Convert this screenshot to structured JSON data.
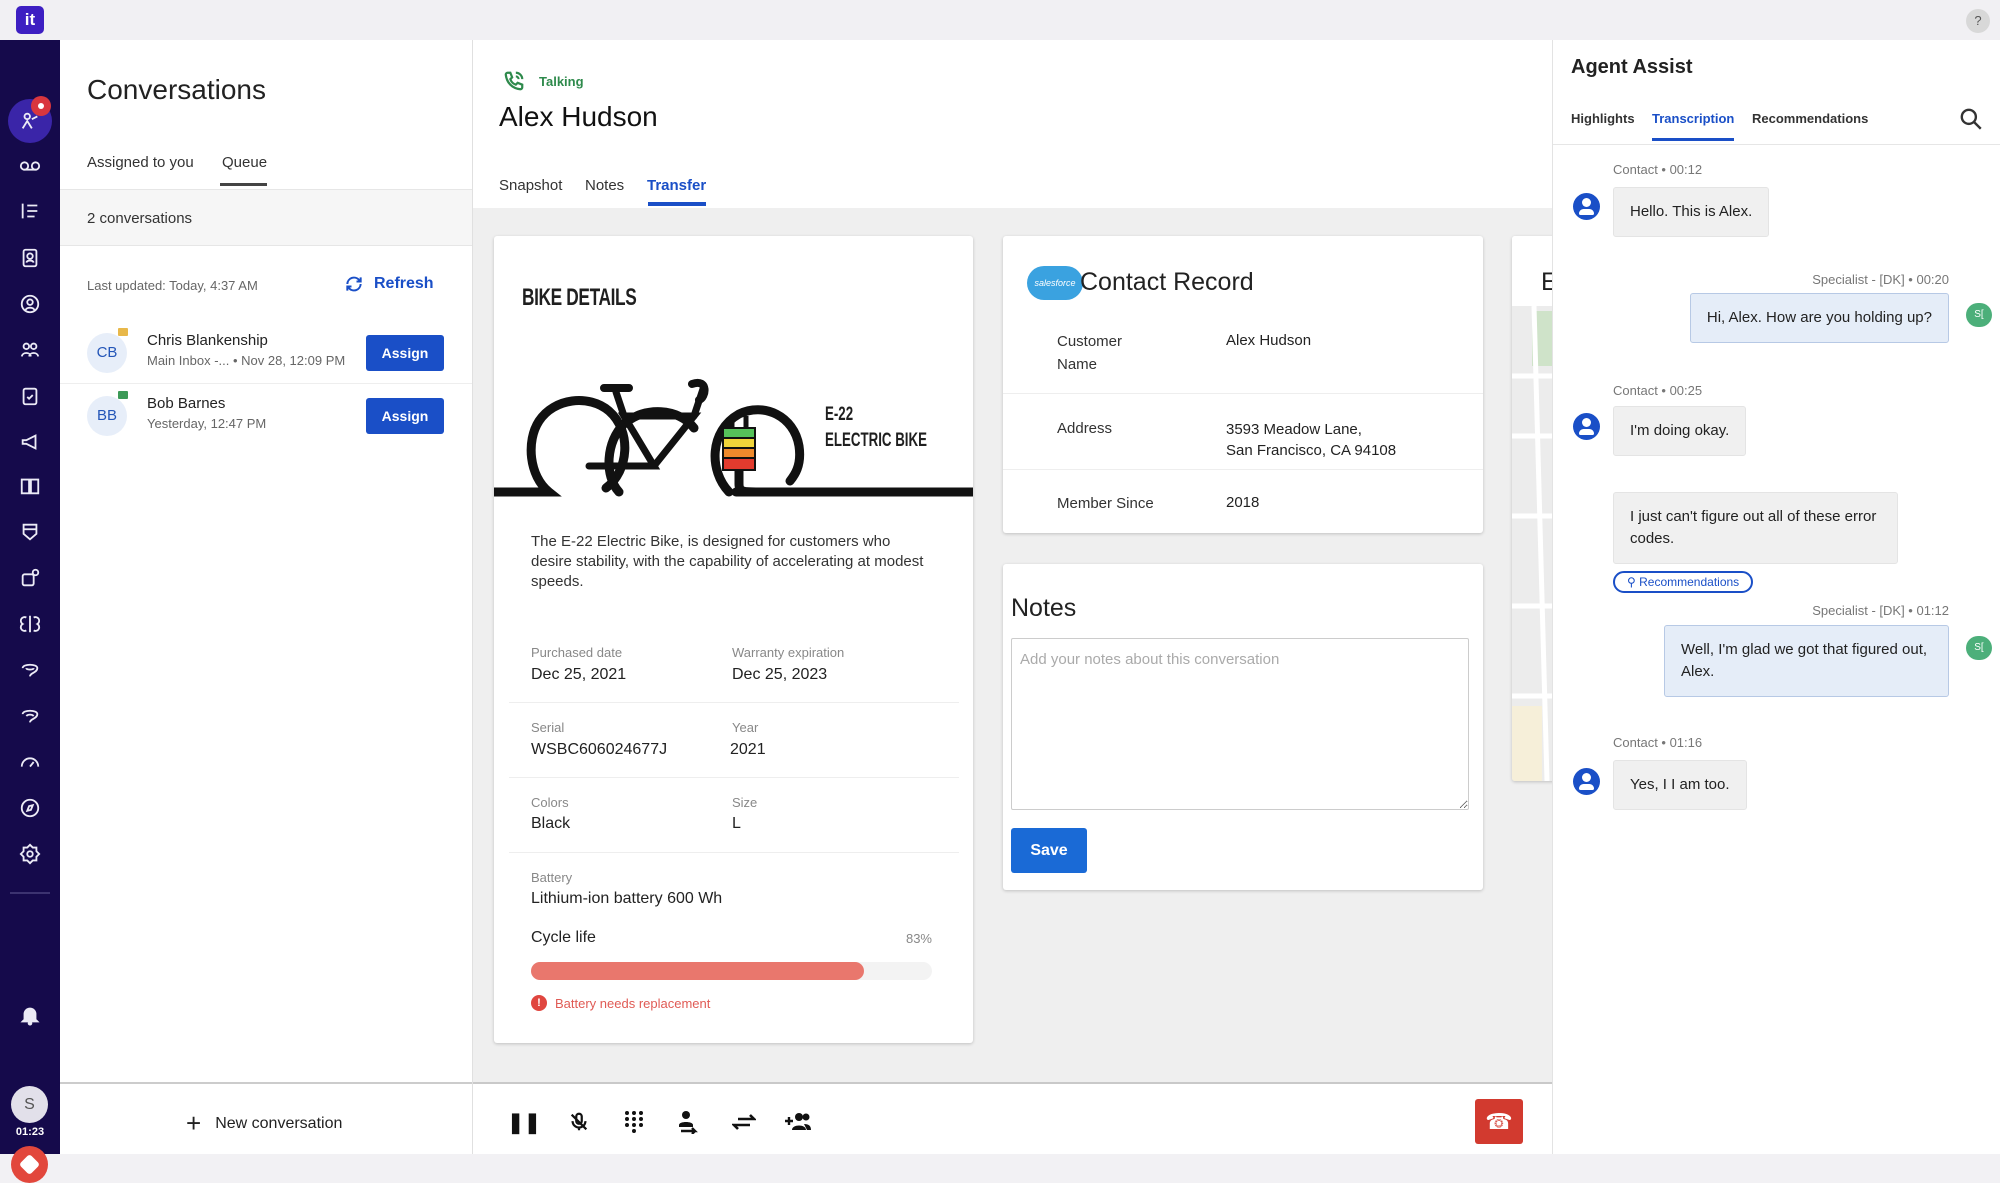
{
  "app": {
    "logo": "it"
  },
  "nav": {
    "items": [
      "conversations",
      "voicemail",
      "task-list",
      "contact-book",
      "agent-status",
      "teams",
      "clipboard-check",
      "megaphone",
      "book",
      "shield",
      "settings-sparkle",
      "brain",
      "chat",
      "chat-alt",
      "speedometer",
      "compass",
      "settings"
    ],
    "user_initial": "S",
    "timer": "01:23"
  },
  "conversations": {
    "title": "Conversations",
    "tabs": [
      "Assigned to you",
      "Queue"
    ],
    "active_tab": "Queue",
    "count": "2 conversations",
    "last_updated": "Last updated: Today, 4:37 AM",
    "refresh": "Refresh",
    "items": [
      {
        "initials": "CB",
        "name": "Chris Blankenship",
        "sub": "Main Inbox -...  • Nov 28, 12:09 PM",
        "channel": "email",
        "channel_color": "#e8b84a",
        "action": "Assign"
      },
      {
        "initials": "BB",
        "name": "Bob Barnes",
        "sub": "Yesterday, 12:47 PM",
        "channel": "sms",
        "channel_color": "#3c9a57",
        "action": "Assign"
      }
    ],
    "new": "New conversation"
  },
  "call": {
    "status": "Talking",
    "contact": "Alex Hudson",
    "tabs": [
      "Snapshot",
      "Notes",
      "Transfer"
    ],
    "active_tab": "Transfer"
  },
  "bike": {
    "title": "BIKE DETAILS",
    "model_line1": "E-22",
    "model_line2": "ELECTRIC BIKE",
    "description": "The E-22 Electric Bike, is designed for customers who desire stability, with the capability of accelerating at modest speeds.",
    "fields": [
      {
        "label": "Purchased date",
        "value": "Dec 25, 2021"
      },
      {
        "label": "Warranty expiration",
        "value": "Dec 25, 2023"
      },
      {
        "label": "Serial",
        "value": "WSBC606024677J"
      },
      {
        "label": "Year",
        "value": "2021"
      },
      {
        "label": "Colors",
        "value": "Black"
      },
      {
        "label": "Size",
        "value": "L"
      }
    ],
    "battery_label": "Battery",
    "battery_value": "Lithium-ion battery 600 Wh",
    "cycle_label": "Cycle life",
    "cycle_pct": "83%",
    "cycle_value": 83,
    "warning": "Battery needs replacement"
  },
  "contact_record": {
    "logo": "salesforce",
    "title": "Contact Record",
    "rows": [
      {
        "label": "Customer Name",
        "value": "Alex Hudson"
      },
      {
        "label": "Address",
        "value_line1": "3593 Meadow Lane,",
        "value_line2": "San Francisco, CA 94108"
      },
      {
        "label": "Member Since",
        "value": "2018"
      }
    ]
  },
  "notes": {
    "title": "Notes",
    "placeholder": "Add your notes about this conversation",
    "value": "",
    "save": "Save"
  },
  "map": {
    "title_partial": "E"
  },
  "toolbar": {
    "icons": [
      "pause",
      "mute-mic",
      "dialpad",
      "consult",
      "transfer",
      "add-participant"
    ],
    "end": "end-call"
  },
  "assist": {
    "title": "Agent Assist",
    "tabs": [
      "Highlights",
      "Transcription",
      "Recommendations"
    ],
    "active_tab": "Transcription",
    "messages": [
      {
        "role": "contact",
        "meta": "Contact • 00:12",
        "text": "Hello. This is Alex."
      },
      {
        "role": "specialist",
        "meta": "Specialist - [DK] • 00:20",
        "text": "Hi, Alex. How are you holding up?"
      },
      {
        "role": "contact",
        "meta": "Contact • 00:25",
        "text": "I'm doing okay."
      },
      {
        "role": "contact",
        "meta": "",
        "text": "I just can't figure out all of these error codes."
      },
      {
        "role": "specialist",
        "meta": "Specialist - [DK] • 01:12",
        "text": "Well, I'm glad we got that figured out, Alex."
      },
      {
        "role": "contact",
        "meta": "Contact • 01:16",
        "text": "Yes, I I am too."
      }
    ],
    "recommendations_pill": "Recommendations",
    "specialist_avatar": "S["
  }
}
